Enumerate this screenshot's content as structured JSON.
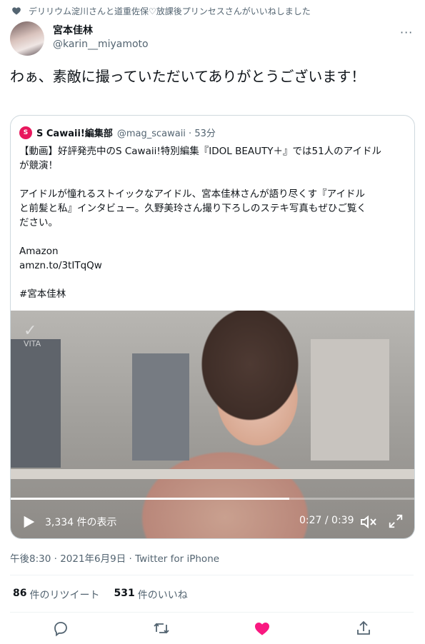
{
  "social_context": "デリリウム淀川さんと道重佐保♡放課後プリンセスさんがいいねしました",
  "author": {
    "display_name": "宮本佳林",
    "handle": "@karin__miyamoto"
  },
  "more_label": "···",
  "tweet_text": "わぁ、素敵に撮っていただいてありがとうございます！",
  "quote": {
    "logo_text": "S",
    "name": "S Cawaii!編集部",
    "handle": "@mag_scawaii · 53分",
    "lines": [
      "【動画】好評発売中のS Cawaii!特別編集『IDOL BEAUTY＋』では51人のアイドル",
      "が競演！",
      "",
      "アイドルが憧れるストイックなアイドル、宮本佳林さんが語り尽くす『アイドル",
      "と前髪と私』インタビュー。久野美玲さん撮り下ろしのステキ写真もぜひご覧く",
      "ださい。",
      "",
      "Amazon",
      "amzn.to/3tITqQw",
      "",
      "#宮本佳林"
    ]
  },
  "video": {
    "logo_text": "VITA",
    "views": "3,334 件の表示",
    "time": "0:27 / 0:39",
    "progress": 0.69
  },
  "meta": "午後8:30 · 2021年6月9日 · Twitter for iPhone",
  "stats": {
    "retweets_count": "86",
    "retweets_label": "件のリツイート",
    "likes_count": "531",
    "likes_label": "件のいいね"
  },
  "colors": {
    "like_active": "#f91880",
    "icon_gray": "#536471"
  }
}
